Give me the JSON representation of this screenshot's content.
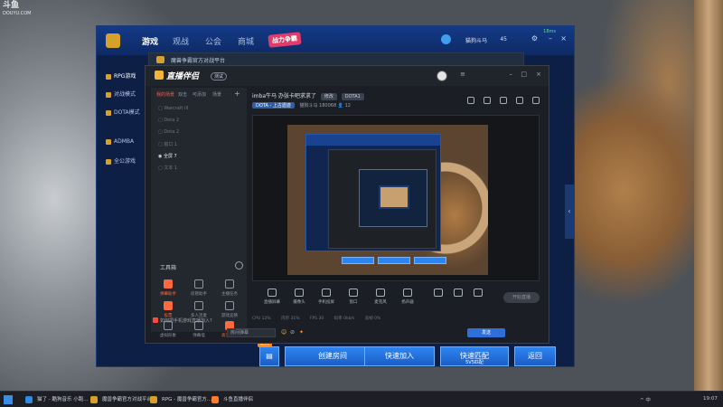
{
  "watermark": {
    "brand": "斗鱼",
    "sub": "DOUYU.COM"
  },
  "outer": {
    "nav": [
      "游戏",
      "观战",
      "公会",
      "商城"
    ],
    "promo": "战力争霸",
    "user_name": "猫狗斗马",
    "coin_count": "45",
    "net_status": "18ms",
    "menu": [
      {
        "label": "RPG游戏"
      },
      {
        "label": "对战模式"
      },
      {
        "label": "DOTA模式"
      },
      {
        "label": "ADMBA"
      },
      {
        "label": "全公游戏"
      }
    ],
    "bottom": {
      "room_tag": "进入",
      "create_room": "创建房间",
      "quick_join": "快速加入",
      "quick_match": "快速匹配",
      "quick_match_sub": "5V5匹配",
      "back": "返回"
    }
  },
  "platform": {
    "title": "魔兽争霸官方对战平台"
  },
  "assistant": {
    "logo": "直播伴侣",
    "version": "测试",
    "window_controls": [
      "–",
      "□",
      "×"
    ],
    "tabs": [
      "我的场景",
      "双击",
      "可添加",
      "场景"
    ],
    "scenes": [
      {
        "label": "Warcraft III",
        "active": false
      },
      {
        "label": "Dota 2",
        "active": false
      },
      {
        "label": "Dota 2",
        "active": false
      },
      {
        "label": "窗口 1",
        "active": false
      },
      {
        "label": "全屏 7",
        "active": true
      },
      {
        "label": "文本 1",
        "active": false
      }
    ],
    "tools_title": "工具箱",
    "tools": [
      {
        "label": "弹幕助手",
        "hot": true
      },
      {
        "label": "房管助手",
        "hot": false
      },
      {
        "label": "主播任务",
        "hot": false
      },
      {
        "label": "投票",
        "hot": true
      },
      {
        "label": "多人连麦",
        "hot": false
      },
      {
        "label": "游戏竞猜",
        "hot": false
      },
      {
        "label": "虚拟形象",
        "hot": false
      },
      {
        "label": "弹幕墙",
        "hot": false
      },
      {
        "label": "高清投屏",
        "hot": true
      }
    ],
    "notice": "如何把手机游戏直播加入?",
    "stream_title": "imba牛马 办张卡吧求求了",
    "edit_label": "修改",
    "category": "DOTA1",
    "category_chip": "DOTA - 上古遗迹",
    "room_owner": "猫狗斗马",
    "room_id": "180068",
    "viewer_count": "12",
    "controls": [
      "直播屏幕",
      "摄像头",
      "手机投屏",
      "窗口",
      "麦克风",
      "扬声器"
    ],
    "start_live": "开始直播",
    "status": [
      "CPU 12%",
      "内存 31%",
      "FPS 30",
      "码率 0kb/s",
      "丢帧 0%"
    ],
    "chat_placeholder": "房间弹幕",
    "send": "发送"
  },
  "taskbar": {
    "tasks": [
      {
        "label": "猫了 - 酷狗音乐 小跑...",
        "color": "#2f8be8"
      },
      {
        "label": "魔兽争霸官方对战平台",
        "color": "#d7a02b"
      },
      {
        "label": "RPG - 魔兽争霸官方...",
        "color": "#d7a02b"
      },
      {
        "label": "斗鱼直播伴侣",
        "color": "#ff7a2a"
      }
    ],
    "tray": "^ 中",
    "time": "19:07"
  }
}
